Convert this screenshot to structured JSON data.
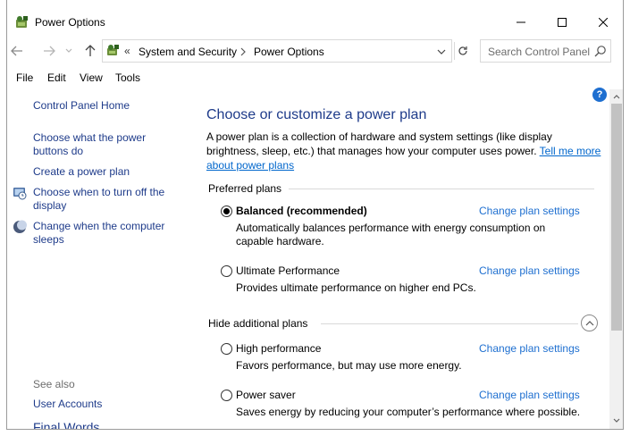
{
  "window": {
    "title": "Power Options",
    "controls": {
      "minimize_icon": "minimize-icon",
      "maximize_icon": "maximize-icon",
      "close_icon": "close-icon"
    }
  },
  "address": {
    "chevron": "«",
    "crumbs": [
      "System and Security",
      "Power Options"
    ],
    "search_placeholder": "Search Control Panel"
  },
  "menu": {
    "items": [
      "File",
      "Edit",
      "View",
      "Tools"
    ]
  },
  "help": {
    "label": "?"
  },
  "sidebar": {
    "home": "Control Panel Home",
    "links": [
      "Choose what the power buttons do",
      "Create a power plan",
      "Choose when to turn off the display",
      "Change when the computer sleeps"
    ],
    "see_also": "See also",
    "see_also_links": [
      "User Accounts"
    ],
    "cut_off_text": "Final Words"
  },
  "main": {
    "title": "Choose or customize a power plan",
    "description": "A power plan is a collection of hardware and system settings (like display brightness, sleep, etc.) that manages how your computer uses power.",
    "tell_me_more": "Tell me more about power plans",
    "preferred_heading": "Preferred plans",
    "additional_heading": "Hide additional plans",
    "change_link": "Change plan settings",
    "plans": [
      {
        "name": "Balanced (recommended)",
        "desc": "Automatically balances performance with energy consumption on capable hardware.",
        "selected": true
      },
      {
        "name": "Ultimate Performance",
        "desc": "Provides ultimate performance on higher end PCs.",
        "selected": false
      },
      {
        "name": "High performance",
        "desc": "Favors performance, but may use more energy.",
        "selected": false
      },
      {
        "name": "Power saver",
        "desc": "Saves energy by reducing your computer’s performance where possible.",
        "selected": false
      }
    ]
  },
  "colors": {
    "link": "#1e6fd0",
    "heading": "#1e3b8a",
    "help_badge": "#1e6fd0"
  }
}
